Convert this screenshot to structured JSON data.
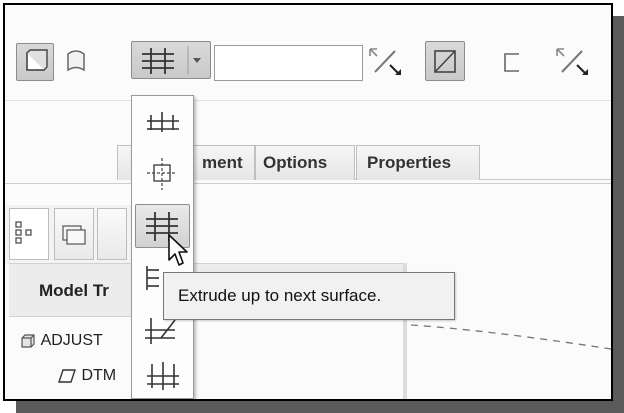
{
  "depth_panel": {
    "depth_value": "",
    "options_icon": "depth-options-icon",
    "selected_option_icon": "to-next-surface-icon"
  },
  "tabs": [
    {
      "label": "Placement",
      "visible_label": "ment"
    },
    {
      "label": "Options"
    },
    {
      "label": "Properties"
    }
  ],
  "model_panel": {
    "title": "Model Tr",
    "tree_items": [
      {
        "label": "ADJUST"
      },
      {
        "label": "DTM"
      }
    ]
  },
  "flyout_options": [
    {
      "icon": "blind-icon"
    },
    {
      "icon": "symmetric-icon"
    },
    {
      "icon": "to-next-icon",
      "highlighted": true
    },
    {
      "icon": "through-all-icon"
    },
    {
      "icon": "through-until-icon"
    },
    {
      "icon": "to-selected-icon"
    }
  ],
  "tooltip": {
    "text": "Extrude up to next surface."
  },
  "colors": {
    "highlight": "#d2d2d2",
    "border": "#8c8c8c",
    "frame": "#000000",
    "shadow": "#5a5a5a"
  }
}
